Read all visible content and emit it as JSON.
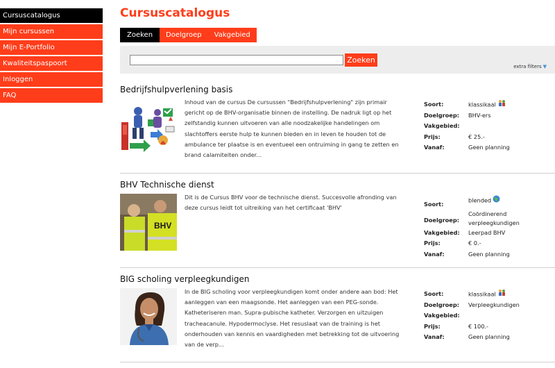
{
  "sidebar": {
    "items": [
      {
        "label": "Cursuscatalogus",
        "active": true
      },
      {
        "label": "Mijn cursussen",
        "active": false
      },
      {
        "label": "Mijn E-Portfolio",
        "active": false
      },
      {
        "label": "Kwaliteitspaspoort",
        "active": false
      },
      {
        "label": "Inloggen",
        "active": false
      },
      {
        "label": "FAQ",
        "active": false
      }
    ]
  },
  "main": {
    "title": "Cursuscatalogus",
    "tabs": [
      "Zoeken",
      "Doelgroep",
      "Vakgebied"
    ],
    "search": {
      "value": "",
      "placeholder": "",
      "button_label": "Zoeken",
      "extra_filters": "extra filters"
    }
  },
  "labels": {
    "soort": "Soort:",
    "doelgroep": "Doelgroep:",
    "vakgebied": "Vakgebied:",
    "prijs": "Prijs:",
    "vanaf": "Vanaf:"
  },
  "courses": [
    {
      "title": "Bedrijfshulpverlening basis",
      "description": "Inhoud van de cursus De cursussen \"Bedrijfshulpverlening\" zijn primair gericht op de BHV-organisatie binnen de instelling. De nadruk ligt op het zelfstandig kunnen uitvoeren van alle noodzakelijke handelingen om slachtoffers eerste hulp te kunnen bieden en in leven te houden tot de ambulance ter plaatse is en eventueel een ontruiming in gang te zetten en brand calamiteiten onder...",
      "soort": "klassikaal",
      "soort_icon": "classroom-icon",
      "doelgroep": "BHV-ers",
      "vakgebied": "",
      "prijs": "€ 25.-",
      "vanaf": "Geen planning"
    },
    {
      "title": "BHV Technische dienst",
      "description": "Dit is de Cursus BHV voor de technische dienst. Succesvolle afronding van deze cursus leidt tot uitreiking van het certificaat 'BHV'",
      "soort": "blended",
      "soort_icon": "globe-icon",
      "doelgroep": "Coördinerend verpleegkundigen",
      "vakgebied": "Leerpad BHV",
      "prijs": "€ 0.-",
      "vanaf": "Geen planning"
    },
    {
      "title": "BIG scholing verpleegkundigen",
      "description": "In de BIG scholing voor verpleegkundigen komt onder andere aan bod: Het aanleggen van een maagsonde. Het aanleggen van een PEG-sonde. Katheteriseren man. Supra-pubische katheter. Verzorgen en uitzuigen tracheacanule. Hypodermoclyse. Het resuslaat van de training is het onderhouden van kennis en vaardigheden met betrekking tot de uitvoering van de verp...",
      "soort": "klassikaal",
      "soort_icon": "classroom-icon",
      "doelgroep": "Verpleegkundigen",
      "vakgebied": "",
      "prijs": "€ 100.-",
      "vanaf": "Geen planning"
    }
  ],
  "colors": {
    "accent": "#ff3d1a",
    "active": "#000000",
    "search_bg": "#ededed"
  }
}
